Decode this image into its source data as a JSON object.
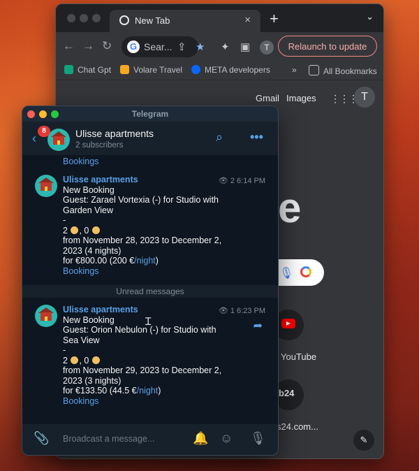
{
  "browser": {
    "tab_title": "New Tab",
    "new_tab_glyph": "+",
    "tab_close_glyph": "×",
    "tab_menu_glyph": "⌄",
    "omnibox_text": "Sear...",
    "profile_initial": "T",
    "relaunch_label": "Relaunch to update",
    "bookmarks": [
      {
        "label": "Chat Gpt",
        "icon": "chatgpt-icon",
        "color": "#10a37f"
      },
      {
        "label": "Volare Travel",
        "icon": "plane-icon",
        "color": "#f5a623"
      },
      {
        "label": "META developers",
        "icon": "meta-icon",
        "color": "#0866ff"
      }
    ],
    "bookmarks_overflow": "»",
    "all_bookmarks_label": "All Bookmarks",
    "google_links": [
      "Gmail",
      "Images"
    ],
    "account_initial": "T",
    "logo_fragment": "e",
    "shortcuts": [
      {
        "label": "YouTube",
        "icon": "youtube-icon",
        "glyph": "▶"
      },
      {
        "label": "s24.com...",
        "icon": "bitrix24-icon",
        "glyph": "b24"
      }
    ],
    "customize_glyph": "✎"
  },
  "telegram": {
    "window_title": "Telegram",
    "unread_count": "8",
    "channel_name": "Ulisse apartments",
    "subscribers": "2 subscribers",
    "prev_link_label": "Bookings",
    "messages": [
      {
        "sender": "Ulisse apartments",
        "views": "2",
        "time": "6:14 PM",
        "line1": "New Booking",
        "line2": "Guest: Zarael Vortexia (-) for Studio with",
        "line3": "Garden View",
        "dash": "-",
        "adults": "2",
        "children": "0",
        "dates1": "from November 28, 2023 to December 2,",
        "dates2": "2023 (4 nights)",
        "price_prefix": "for €800.00 (200 €",
        "price_link": "/night",
        "price_suffix": ")",
        "link_label": "Bookings"
      },
      {
        "sender": "Ulisse apartments",
        "views": "1",
        "time": "6:23 PM",
        "line1": "New Booking",
        "line2": "Guest: Orion Nebulon (-) for Studio with",
        "line3": "Sea View",
        "dash": "-",
        "adults": "2",
        "children": "0",
        "dates1": "from November 29, 2023 to December 2,",
        "dates2": "2023 (3 nights)",
        "price_prefix": "for €133.50 (44.5 €",
        "price_link": "/night",
        "price_suffix": ")",
        "link_label": "Bookings"
      }
    ],
    "unread_divider": "Unread messages",
    "composer_placeholder": "Broadcast a message..."
  }
}
